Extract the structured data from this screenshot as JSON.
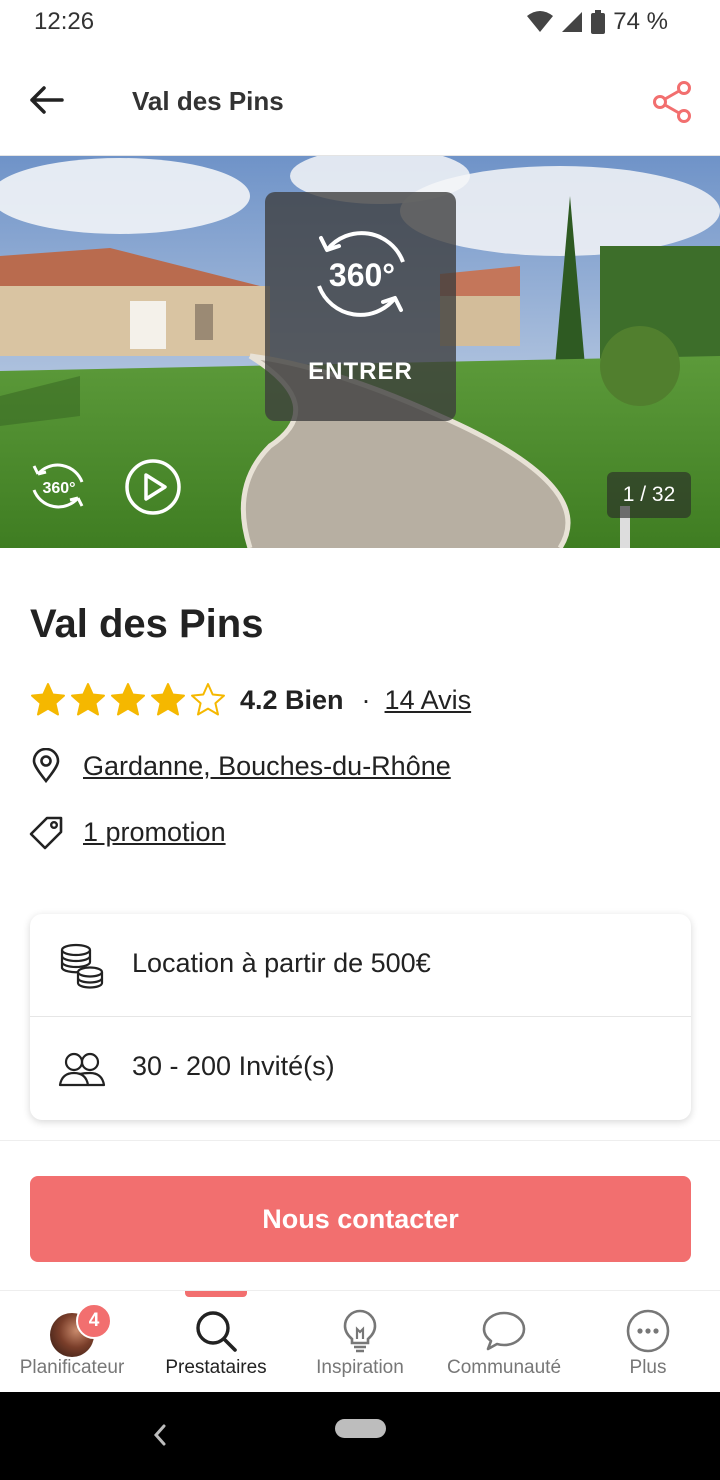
{
  "status_bar": {
    "time": "12:26",
    "battery": "74 %",
    "icons": [
      "wifi-icon",
      "cell-signal-icon",
      "battery-icon"
    ]
  },
  "app_bar": {
    "title": "Val des Pins",
    "back_icon": "arrow-left-icon",
    "share_icon": "share-icon"
  },
  "hero": {
    "tour_badge": "360°",
    "tour_label": "ENTRER",
    "small_360_label": "360°",
    "photo_counter": "1 / 32"
  },
  "venue": {
    "name": "Val des Pins",
    "rating_stars": 4,
    "rating_max": 5,
    "rating_text": "4.2 Bien",
    "separator": "·",
    "reviews": "14 Avis",
    "location": "Gardanne, Bouches-du-Rhône",
    "promotion": "1 promotion"
  },
  "details": [
    {
      "icon": "coins-icon",
      "text": "Location à partir de 500€"
    },
    {
      "icon": "guests-icon",
      "text": "30 - 200 Invité(s)"
    }
  ],
  "cta": {
    "label": "Nous contacter"
  },
  "bottom_nav": {
    "active": "Prestataires",
    "items": [
      {
        "label": "Planificateur",
        "icon": "avatar",
        "badge": "4"
      },
      {
        "label": "Prestataires",
        "icon": "search-icon"
      },
      {
        "label": "Inspiration",
        "icon": "lightbulb-icon"
      },
      {
        "label": "Communauté",
        "icon": "chat-bubble-icon"
      },
      {
        "label": "Plus",
        "icon": "more-icon"
      }
    ]
  },
  "colors": {
    "accent": "#f26f6f",
    "star": "#f5b800",
    "text": "#222222"
  }
}
